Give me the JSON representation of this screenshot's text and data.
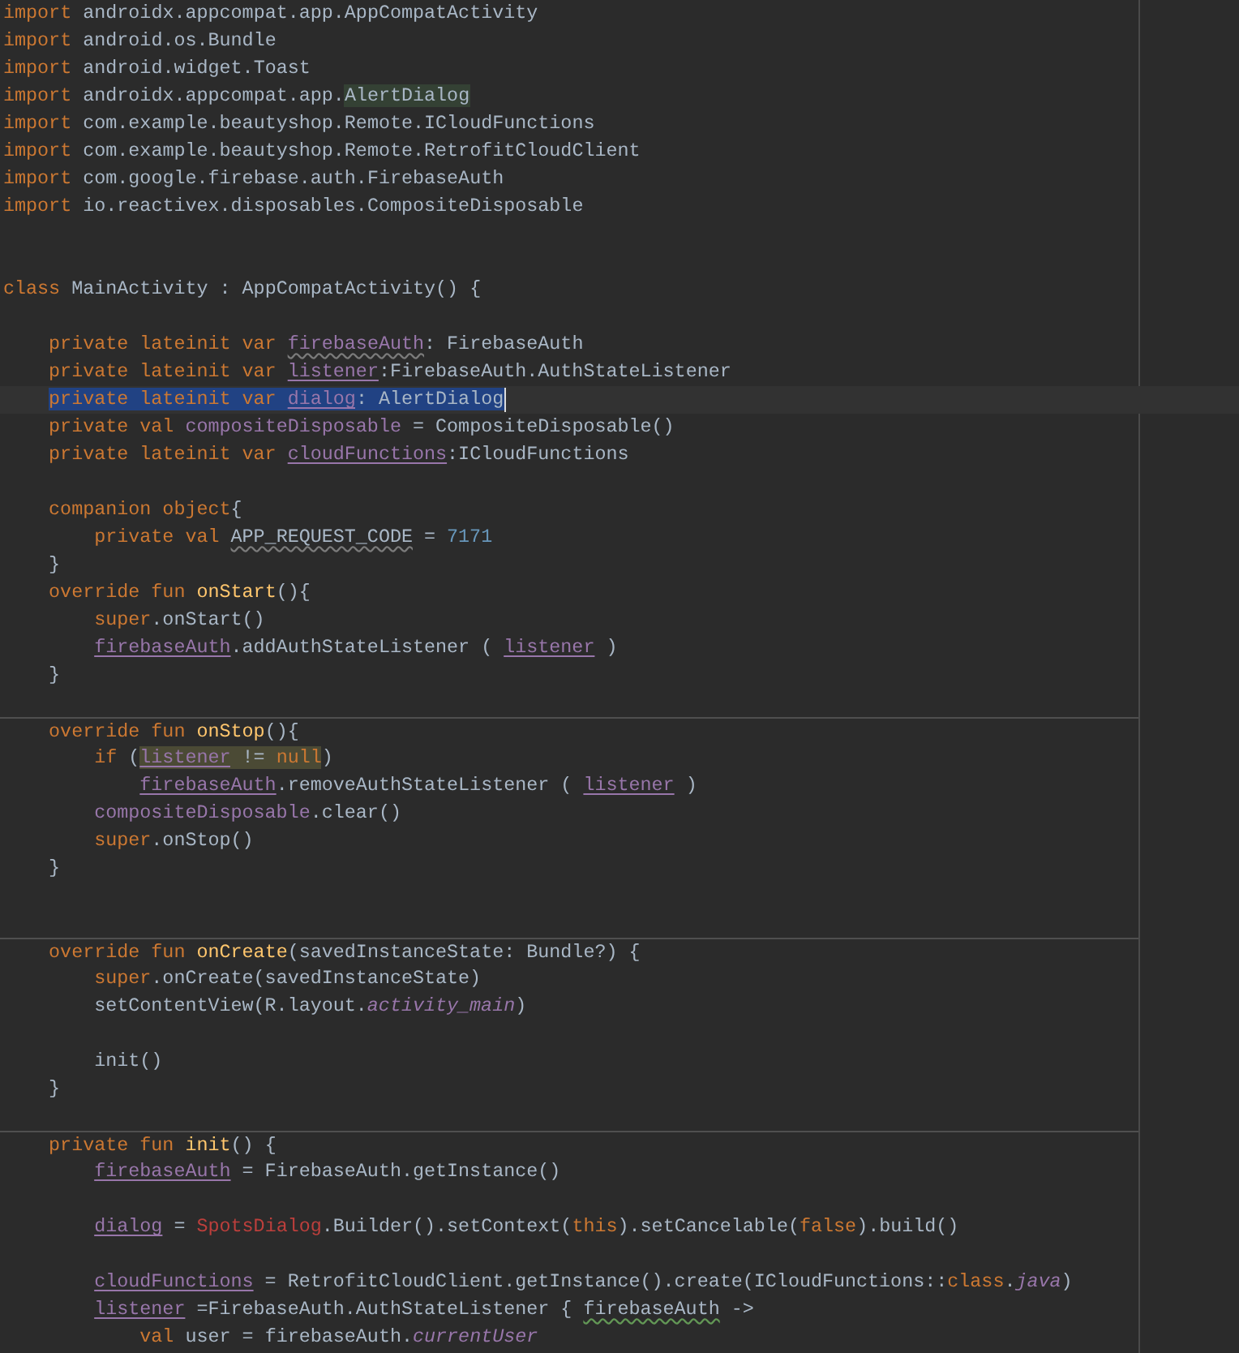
{
  "editor": {
    "lines": [
      {
        "kind": "code",
        "tokens": [
          {
            "text": "import ",
            "kind": "keyword"
          },
          {
            "text": "androidx.appcompat.app.AppCompatActivity",
            "kind": "plain"
          }
        ]
      },
      {
        "kind": "code",
        "tokens": [
          {
            "text": "import ",
            "kind": "keyword"
          },
          {
            "text": "android.os.Bundle",
            "kind": "plain"
          }
        ]
      },
      {
        "kind": "code",
        "tokens": [
          {
            "text": "import ",
            "kind": "keyword"
          },
          {
            "text": "android.widget.Toast",
            "kind": "plain"
          }
        ]
      },
      {
        "kind": "code",
        "tokens": [
          {
            "text": "import ",
            "kind": "keyword"
          },
          {
            "text": "androidx.appcompat.app.",
            "kind": "plain"
          },
          {
            "text": "AlertDialog",
            "kind": "plain",
            "caret_usage_highlighted": true
          }
        ]
      },
      {
        "kind": "code",
        "tokens": [
          {
            "text": "import ",
            "kind": "keyword"
          },
          {
            "text": "com.example.beautyshop.Remote.ICloudFunctions",
            "kind": "plain"
          }
        ]
      },
      {
        "kind": "code",
        "tokens": [
          {
            "text": "import ",
            "kind": "keyword"
          },
          {
            "text": "com.example.beautyshop.Remote.RetrofitCloudClient",
            "kind": "plain"
          }
        ]
      },
      {
        "kind": "code",
        "tokens": [
          {
            "text": "import ",
            "kind": "keyword"
          },
          {
            "text": "com.google.firebase.auth.FirebaseAuth",
            "kind": "plain"
          }
        ]
      },
      {
        "kind": "code",
        "tokens": [
          {
            "text": "import ",
            "kind": "keyword"
          },
          {
            "text": "io.reactivex.disposables.CompositeDisposable",
            "kind": "plain"
          }
        ]
      },
      {
        "kind": "blank"
      },
      {
        "kind": "blank"
      },
      {
        "kind": "code",
        "tokens": [
          {
            "text": "class ",
            "kind": "keyword"
          },
          {
            "text": "MainActivity : AppCompatActivity() {",
            "kind": "plain"
          }
        ],
        "children": [
          {
            "kind": "blank"
          },
          {
            "kind": "code",
            "tokens": [
              {
                "text": "private lateinit var ",
                "kind": "keyword"
              },
              {
                "text": "firebaseAuth",
                "kind": "property",
                "weak_warning": true
              },
              {
                "text": ": FirebaseAuth",
                "kind": "plain"
              }
            ]
          },
          {
            "kind": "code",
            "tokens": [
              {
                "text": "private lateinit var ",
                "kind": "keyword"
              },
              {
                "text": "listener",
                "kind": "property",
                "underlined": true
              },
              {
                "text": ":FirebaseAuth.AuthStateListener",
                "kind": "plain"
              }
            ]
          },
          {
            "kind": "code",
            "selected": true,
            "caret": true,
            "tokens": [
              {
                "text": "private lateinit var ",
                "kind": "keyword"
              },
              {
                "text": "dialog",
                "kind": "property",
                "underlined": true
              },
              {
                "text": ": AlertDialog",
                "kind": "plain"
              }
            ]
          },
          {
            "kind": "code",
            "tokens": [
              {
                "text": "private val ",
                "kind": "keyword"
              },
              {
                "text": "compositeDisposable",
                "kind": "property"
              },
              {
                "text": " = CompositeDisposable()",
                "kind": "plain"
              }
            ]
          },
          {
            "kind": "code",
            "tokens": [
              {
                "text": "private lateinit var ",
                "kind": "keyword"
              },
              {
                "text": "cloudFunctions",
                "kind": "property",
                "underlined": true
              },
              {
                "text": ":ICloudFunctions",
                "kind": "plain"
              }
            ]
          },
          {
            "kind": "blank"
          },
          {
            "kind": "code",
            "tokens": [
              {
                "text": "companion object",
                "kind": "keyword"
              },
              {
                "text": "{",
                "kind": "plain"
              }
            ],
            "children": [
              {
                "kind": "code",
                "tokens": [
                  {
                    "text": "private val ",
                    "kind": "keyword"
                  },
                  {
                    "text": "APP_REQUEST_CODE",
                    "kind": "plain",
                    "weak_warning": true
                  },
                  {
                    "text": " = ",
                    "kind": "plain"
                  },
                  {
                    "text": "7171",
                    "kind": "number"
                  }
                ]
              }
            ]
          },
          {
            "kind": "code",
            "tokens": [
              {
                "text": "}",
                "kind": "plain"
              }
            ]
          },
          {
            "kind": "code",
            "tokens": [
              {
                "text": "override fun ",
                "kind": "keyword"
              },
              {
                "text": "onStart",
                "kind": "function"
              },
              {
                "text": "(){",
                "kind": "plain"
              }
            ],
            "children": [
              {
                "kind": "code",
                "tokens": [
                  {
                    "text": "super",
                    "kind": "keyword"
                  },
                  {
                    "text": ".onStart()",
                    "kind": "plain"
                  }
                ]
              },
              {
                "kind": "code",
                "tokens": [
                  {
                    "text": "firebaseAuth",
                    "kind": "property",
                    "underlined": true
                  },
                  {
                    "text": ".addAuthStateListener ( ",
                    "kind": "plain"
                  },
                  {
                    "text": "listener",
                    "kind": "property",
                    "underlined": true
                  },
                  {
                    "text": " )",
                    "kind": "plain"
                  }
                ]
              }
            ]
          },
          {
            "kind": "code",
            "tokens": [
              {
                "text": "}",
                "kind": "plain"
              }
            ]
          },
          {
            "kind": "blank"
          },
          {
            "kind": "code",
            "separator_above": true,
            "tokens": [
              {
                "text": "override fun ",
                "kind": "keyword"
              },
              {
                "text": "onStop",
                "kind": "function"
              },
              {
                "text": "(){",
                "kind": "plain"
              }
            ],
            "children": [
              {
                "kind": "code",
                "tokens": [
                  {
                    "text": "if ",
                    "kind": "keyword"
                  },
                  {
                    "text": "(",
                    "kind": "plain"
                  },
                  {
                    "text": "listener",
                    "kind": "property",
                    "underlined": true,
                    "highlighted": true
                  },
                  {
                    "text": " != ",
                    "kind": "plain",
                    "highlighted": true
                  },
                  {
                    "text": "null",
                    "kind": "keyword",
                    "highlighted": true
                  },
                  {
                    "text": ")",
                    "kind": "plain"
                  }
                ],
                "children": [
                  {
                    "kind": "code",
                    "tokens": [
                      {
                        "text": "firebaseAuth",
                        "kind": "property",
                        "underlined": true
                      },
                      {
                        "text": ".removeAuthStateListener ( ",
                        "kind": "plain"
                      },
                      {
                        "text": "listener",
                        "kind": "property",
                        "underlined": true
                      },
                      {
                        "text": " )",
                        "kind": "plain"
                      }
                    ]
                  }
                ]
              },
              {
                "kind": "code",
                "tokens": [
                  {
                    "text": "compositeDisposable",
                    "kind": "property"
                  },
                  {
                    "text": ".clear()",
                    "kind": "plain"
                  }
                ]
              },
              {
                "kind": "code",
                "tokens": [
                  {
                    "text": "super",
                    "kind": "keyword"
                  },
                  {
                    "text": ".onStop()",
                    "kind": "plain"
                  }
                ]
              }
            ]
          },
          {
            "kind": "code",
            "tokens": [
              {
                "text": "}",
                "kind": "plain"
              }
            ]
          },
          {
            "kind": "blank"
          },
          {
            "kind": "blank"
          },
          {
            "kind": "code",
            "separator_above": true,
            "tokens": [
              {
                "text": "override fun ",
                "kind": "keyword"
              },
              {
                "text": "onCreate",
                "kind": "function"
              },
              {
                "text": "(savedInstanceState: Bundle?) {",
                "kind": "plain"
              }
            ],
            "children": [
              {
                "kind": "code",
                "tokens": [
                  {
                    "text": "super",
                    "kind": "keyword"
                  },
                  {
                    "text": ".onCreate(savedInstanceState)",
                    "kind": "plain"
                  }
                ]
              },
              {
                "kind": "code",
                "tokens": [
                  {
                    "text": "setContentView(R.layout.",
                    "kind": "plain"
                  },
                  {
                    "text": "activity_main",
                    "kind": "italic"
                  },
                  {
                    "text": ")",
                    "kind": "plain"
                  }
                ]
              },
              {
                "kind": "blank"
              },
              {
                "kind": "code",
                "tokens": [
                  {
                    "text": "init()",
                    "kind": "plain"
                  }
                ]
              }
            ]
          },
          {
            "kind": "code",
            "tokens": [
              {
                "text": "}",
                "kind": "plain"
              }
            ]
          },
          {
            "kind": "blank"
          },
          {
            "kind": "code",
            "separator_above": true,
            "tokens": [
              {
                "text": "private fun ",
                "kind": "keyword"
              },
              {
                "text": "init",
                "kind": "function"
              },
              {
                "text": "() {",
                "kind": "plain"
              }
            ],
            "children": [
              {
                "kind": "code",
                "tokens": [
                  {
                    "text": "firebaseAuth",
                    "kind": "property",
                    "underlined": true
                  },
                  {
                    "text": " = FirebaseAuth.getInstance()",
                    "kind": "plain"
                  }
                ]
              },
              {
                "kind": "blank"
              },
              {
                "kind": "code",
                "tokens": [
                  {
                    "text": "dialog",
                    "kind": "property",
                    "underlined": true
                  },
                  {
                    "text": " = ",
                    "kind": "plain"
                  },
                  {
                    "text": "SpotsDialog",
                    "kind": "error"
                  },
                  {
                    "text": ".Builder().setContext(",
                    "kind": "plain"
                  },
                  {
                    "text": "this",
                    "kind": "keyword"
                  },
                  {
                    "text": ").setCancelable(",
                    "kind": "plain"
                  },
                  {
                    "text": "false",
                    "kind": "keyword"
                  },
                  {
                    "text": ").build()",
                    "kind": "plain"
                  }
                ]
              },
              {
                "kind": "blank"
              },
              {
                "kind": "code",
                "tokens": [
                  {
                    "text": "cloudFunctions",
                    "kind": "property",
                    "underlined": true
                  },
                  {
                    "text": " = RetrofitCloudClient.getInstance().create(ICloudFunctions::",
                    "kind": "plain"
                  },
                  {
                    "text": "class",
                    "kind": "keyword"
                  },
                  {
                    "text": ".",
                    "kind": "plain"
                  },
                  {
                    "text": "java",
                    "kind": "italic"
                  },
                  {
                    "text": ")",
                    "kind": "plain"
                  }
                ]
              },
              {
                "kind": "code",
                "tokens": [
                  {
                    "text": "listener",
                    "kind": "property",
                    "underlined": true
                  },
                  {
                    "text": " =FirebaseAuth.AuthStateListener { ",
                    "kind": "plain"
                  },
                  {
                    "text": "firebaseAuth",
                    "kind": "plain",
                    "typo": true
                  },
                  {
                    "text": " ->",
                    "kind": "plain"
                  }
                ],
                "children": [
                  {
                    "kind": "code",
                    "tokens": [
                      {
                        "text": "val ",
                        "kind": "keyword"
                      },
                      {
                        "text": "user = firebaseAuth.",
                        "kind": "plain"
                      },
                      {
                        "text": "currentUser",
                        "kind": "italic"
                      }
                    ]
                  }
                ]
              }
            ]
          }
        ]
      }
    ]
  }
}
